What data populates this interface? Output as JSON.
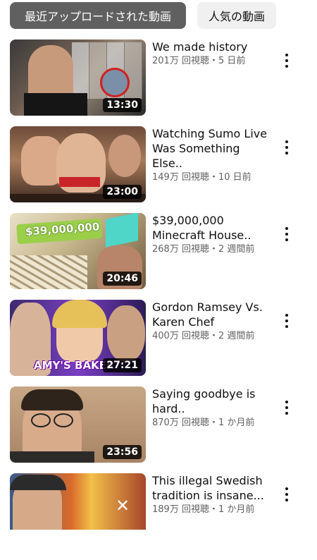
{
  "filters": {
    "recent_label": "最近アップロードされた動画",
    "popular_label": "人気の動画"
  },
  "colors": {
    "chip_selected_bg": "#606060",
    "chip_bg": "#f0f0f0",
    "meta_text": "#606060"
  },
  "videos": [
    {
      "title": "We made history",
      "stats": "201万 回視聴・5 日前",
      "duration": "13:30",
      "thumb_text": ""
    },
    {
      "title": "Watching Sumo Live Was Something Else..",
      "stats": "149万 回視聴・10 日前",
      "duration": "23:00",
      "thumb_text": ""
    },
    {
      "title": "$39,000,000 Minecraft House..",
      "stats": "268万 回視聴・2 週間前",
      "duration": "20:46",
      "thumb_text": "$39,000,000"
    },
    {
      "title": "Gordon Ramsey Vs. Karen Chef",
      "stats": "400万 回視聴・2 週間前",
      "duration": "27:21",
      "thumb_text": "AMY'S BAKER"
    },
    {
      "title": "Saying goodbye is hard..",
      "stats": "870万 回視聴・1 か月前",
      "duration": "23:56",
      "thumb_text": ""
    },
    {
      "title": "This illegal Swedish tradition is insane...",
      "stats": "189万 回視聴・1 か月前",
      "duration": "",
      "thumb_text": ""
    }
  ],
  "icons": {
    "more": "more-vert-icon"
  }
}
